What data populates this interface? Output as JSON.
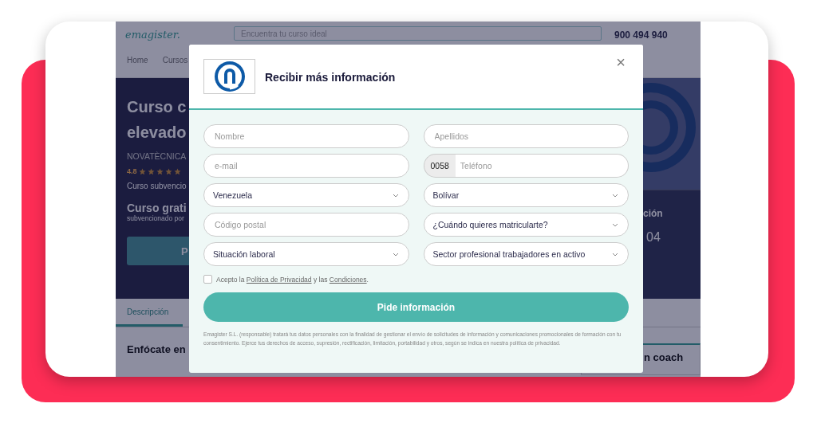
{
  "background_page": {
    "header": {
      "logo": "emagister.",
      "search_placeholder": "Encuentra tu curso ideal",
      "phone": "900 494 940"
    },
    "nav": [
      "Home",
      "Cursos"
    ],
    "hero": {
      "title_lines": [
        "Curso c",
        "elevado"
      ],
      "provider": "NOVATÈCNICA",
      "rating": "4.8",
      "stars": 5,
      "subsidy": "Curso subvencio",
      "price_title": "Curso grati",
      "price_note": "subvencionado por",
      "button": "P",
      "side_label": "ción",
      "side_value": "04"
    },
    "tabs": [
      {
        "label": "Descripción",
        "selected": true
      }
    ],
    "section_title": "Enfócate en",
    "side_card_title": "n coach"
  },
  "modal": {
    "title": "Recibir más información",
    "close": "×",
    "fields": [
      {
        "kind": "input",
        "placeholder": "Nombre"
      },
      {
        "kind": "input",
        "placeholder": "Apellidos"
      },
      {
        "kind": "input",
        "placeholder": "e-mail"
      },
      {
        "kind": "phone",
        "prefix": "0058",
        "placeholder": "Teléfono"
      },
      {
        "kind": "select",
        "value": "Venezuela"
      },
      {
        "kind": "select",
        "value": "Bolívar"
      },
      {
        "kind": "input",
        "placeholder": "Código postal"
      },
      {
        "kind": "select",
        "value": "¿Cuándo quieres matricularte?"
      },
      {
        "kind": "select",
        "value": "Situación laboral"
      },
      {
        "kind": "select",
        "value": "Sector profesional trabajadores en activo"
      }
    ],
    "consent": {
      "checked": false,
      "before": "Acepto la",
      "link_privacy": "Política de Privacidad",
      "middle": "y las",
      "link_conditions": "Condiciones",
      "after": "."
    },
    "submit": "Pide información",
    "legal": "Emagister S.L. (responsable) tratará tus datos personales con la finalidad de gestionar el envío de solicitudes de información y comunicaciones promocionales de formación con tu consentimiento. Ejerce tus derechos de acceso, supresión, rectificación, limitación, portabilidad y otros, según se indica en nuestra política de privacidad."
  }
}
